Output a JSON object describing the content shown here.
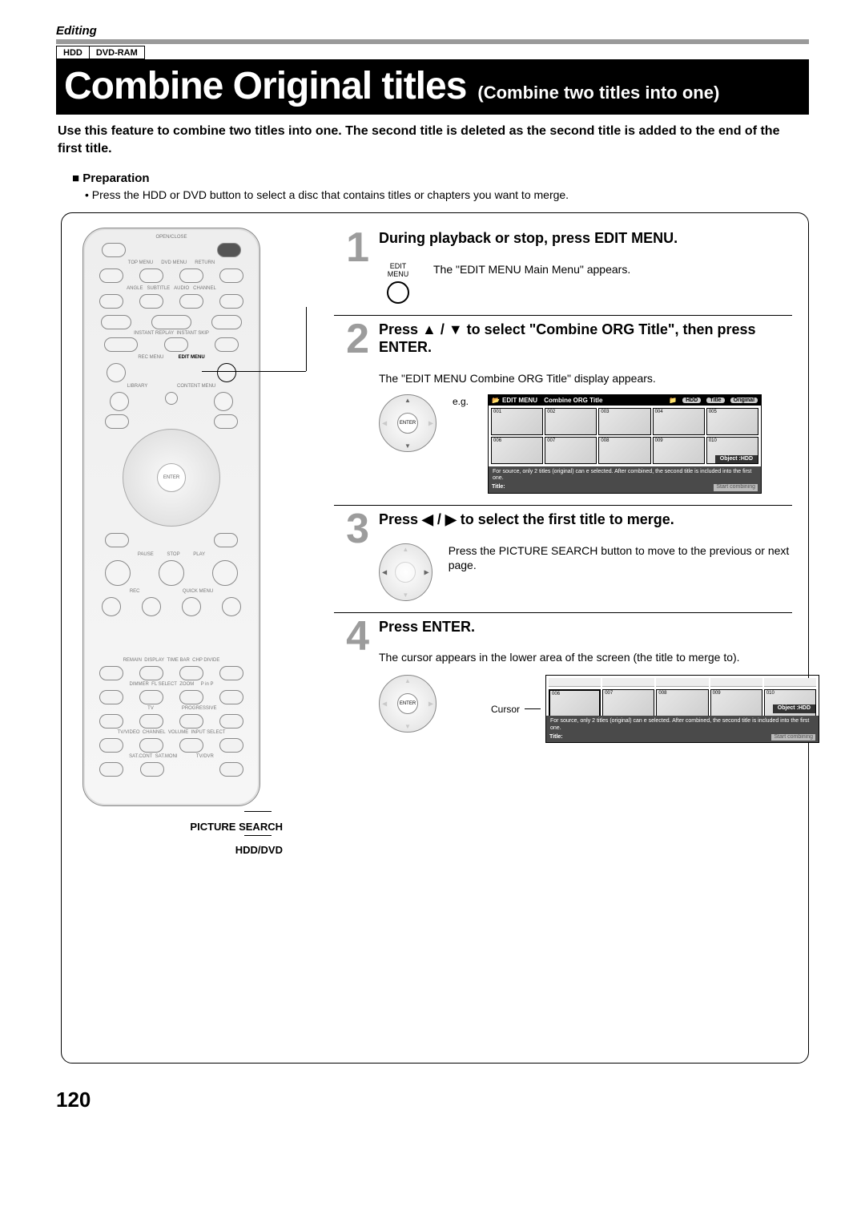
{
  "section": "Editing",
  "tags": [
    "HDD",
    "DVD-RAM"
  ],
  "title": "Combine Original titles",
  "subtitle": "(Combine two titles into one)",
  "intro": "Use this feature to combine two titles into one. The second title is deleted as the second title is added to the end of the first title.",
  "prep_heading": "Preparation",
  "prep_text": "Press the HDD or DVD button to select a disc that contains titles or chapters you want to merge.",
  "remote_labels": {
    "picture_search": "PICTURE SEARCH",
    "hdd_dvd": "HDD/DVD",
    "edit_menu": "EDIT MENU"
  },
  "steps": [
    {
      "num": "1",
      "head": "During playback or stop, press EDIT MENU.",
      "icon_label": "EDIT MENU",
      "text": "The \"EDIT MENU Main Menu\" appears."
    },
    {
      "num": "2",
      "head": "Press ▲ / ▼ to select \"Combine ORG Title\", then press ENTER.",
      "text": "The \"EDIT MENU Combine ORG Title\" display appears.",
      "eg": "e.g."
    },
    {
      "num": "3",
      "head": "Press ◀ / ▶ to select the first title to merge.",
      "text": "Press the PICTURE SEARCH button to move to the previous or next page."
    },
    {
      "num": "4",
      "head": "Press ENTER.",
      "text": "The cursor appears in the lower area of the screen (the title to merge to).",
      "cursor_label": "Cursor"
    }
  ],
  "screen": {
    "menu_label": "EDIT MENU",
    "title_bar": "Combine ORG Title",
    "disc": "HDD",
    "mode_title": "Title",
    "mode_orig": "Original",
    "thumbs": [
      "001",
      "002",
      "003",
      "004",
      "005",
      "006",
      "007",
      "008",
      "009",
      "010"
    ],
    "thumbs_bottom": [
      "006",
      "007",
      "008",
      "009",
      "010"
    ],
    "object_label": "Object :HDD",
    "hint": "For source, only 2 titles (original) can e selected. After combined, the second title is included into the first one.",
    "title_label": "Title:",
    "start_btn": "Start combining"
  },
  "page_number": "120"
}
